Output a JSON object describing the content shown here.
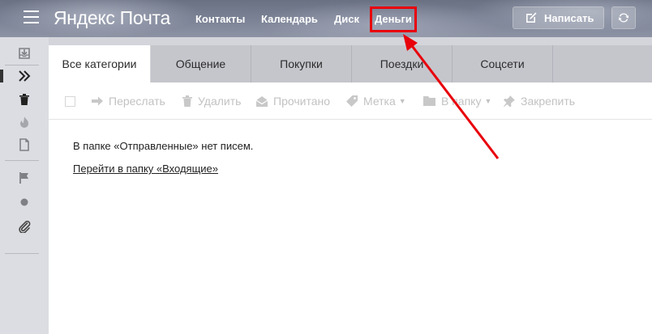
{
  "header": {
    "logo_yandex": "Яндекс",
    "logo_pochta": "Почта",
    "nav": [
      {
        "label": "Контакты"
      },
      {
        "label": "Календарь"
      },
      {
        "label": "Диск"
      },
      {
        "label": "Деньги"
      }
    ],
    "compose_label": "Написать",
    "compose_icon": "compose-icon",
    "refresh_icon": "refresh-icon"
  },
  "sidebar": {
    "icons": [
      "inbox-icon",
      "sent-icon",
      "trash-icon",
      "spam-icon",
      "drafts-icon",
      "flag-icon",
      "unread-dot-icon",
      "attachment-icon"
    ]
  },
  "tabs": [
    {
      "label": "Все категории",
      "active": true
    },
    {
      "label": "Общение"
    },
    {
      "label": "Покупки"
    },
    {
      "label": "Поездки"
    },
    {
      "label": "Соцсети"
    }
  ],
  "toolbar": {
    "forward": "Переслать",
    "delete": "Удалить",
    "read": "Прочитано",
    "label": "Метка",
    "folder": "В папку",
    "pin": "Закрепить"
  },
  "content": {
    "empty_message": "В папке «Отправленные» нет писем.",
    "inbox_link": "Перейти в папку «Входящие»"
  },
  "colors": {
    "annotation": "#e8000b",
    "toolbar_disabled": "#c2c2c2",
    "sidebar_bg": "#dcdde2",
    "tabs_bg": "#c5c6cc"
  }
}
